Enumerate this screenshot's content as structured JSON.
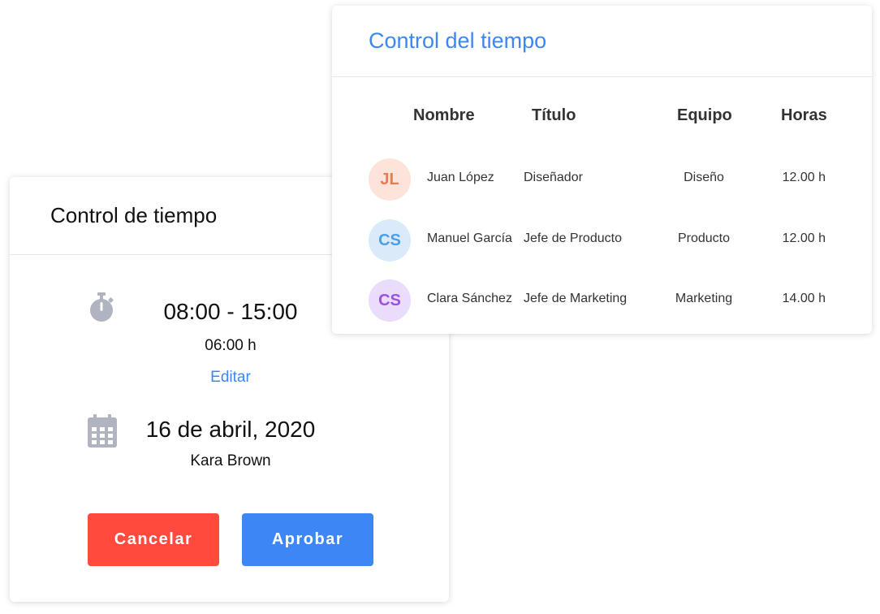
{
  "approval_card": {
    "title": "Control de tiempo",
    "time_range": "08:00 - 15:00",
    "duration": "06:00 h",
    "edit_label": "Editar",
    "date": "16 de abril, 2020",
    "person": "Kara Brown",
    "cancel_label": "Cancelar",
    "approve_label": "Aprobar",
    "icons": {
      "time": "stopwatch-icon",
      "date": "calendar-icon"
    },
    "colors": {
      "cancel": "#ff4a3d",
      "approve": "#3d86f5",
      "icon": "#b0b4c0"
    }
  },
  "time_table": {
    "title": "Control del tiempo",
    "columns": [
      "Nombre",
      "Título",
      "Equipo",
      "Horas"
    ],
    "rows": [
      {
        "initials": "JL",
        "name": "Juan López",
        "title": "Diseñador",
        "team": "Diseño",
        "hours": "12.00 h",
        "avatar_bg": "#fde3da",
        "avatar_fg": "#f07a4a"
      },
      {
        "initials": "CS",
        "name": "Manuel García",
        "title": "Jefe de Producto",
        "team": "Producto",
        "hours": "12.00 h",
        "avatar_bg": "#dbeafb",
        "avatar_fg": "#4a9fe8"
      },
      {
        "initials": "CS",
        "name": "Clara Sánchez",
        "title": "Jefe de Marketing",
        "team": "Marketing",
        "hours": "14.00 h",
        "avatar_bg": "#eadcfb",
        "avatar_fg": "#9b51e0"
      }
    ],
    "colors": {
      "title": "#3d86f5"
    }
  }
}
